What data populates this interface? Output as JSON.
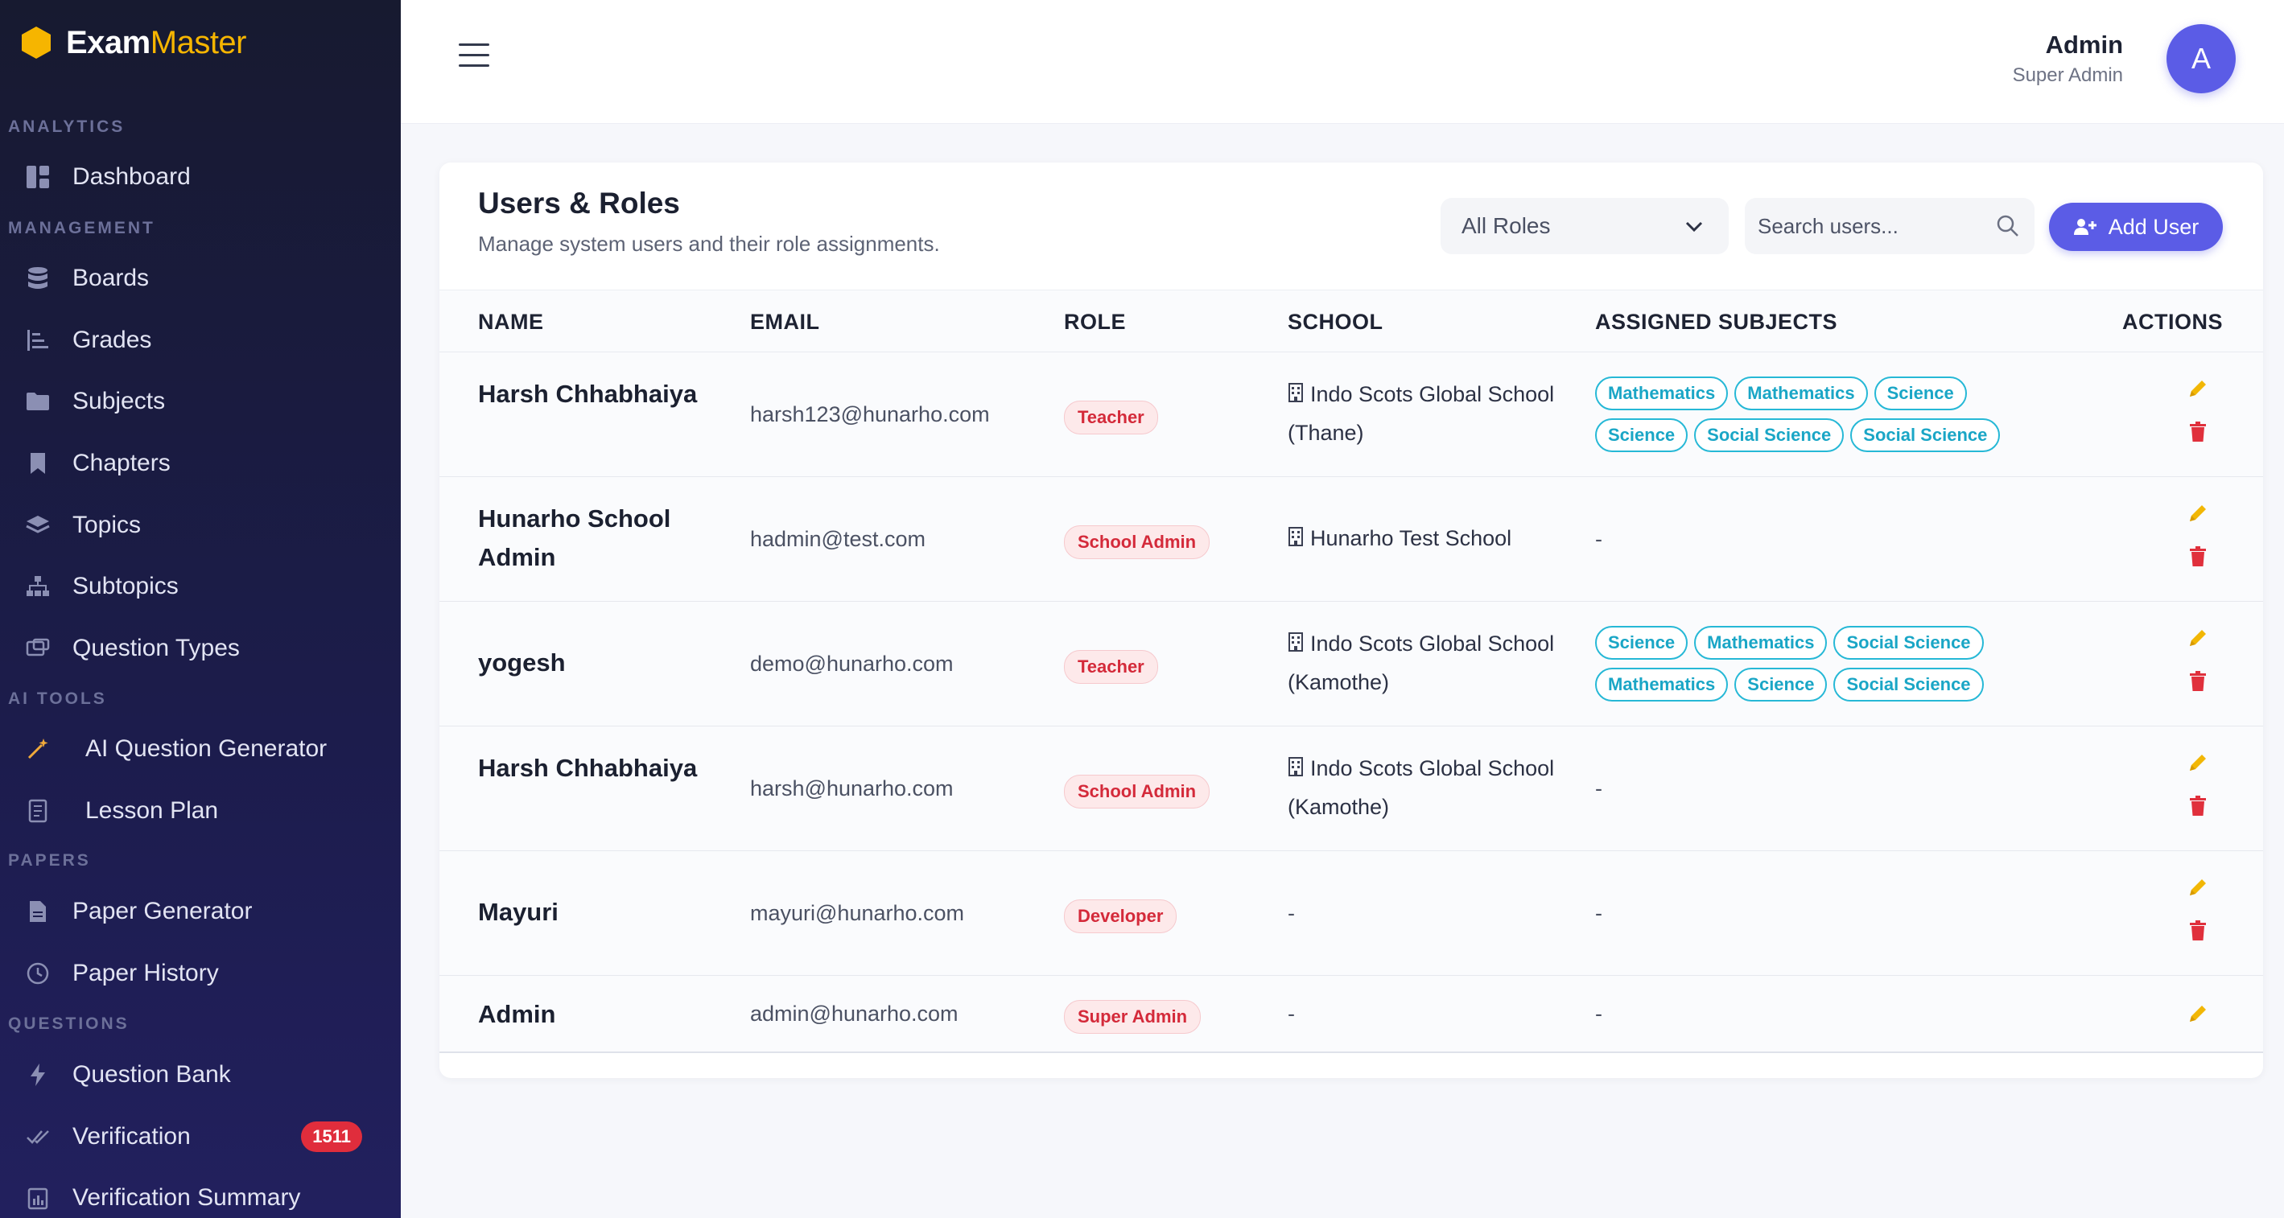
{
  "brand": {
    "name_part1": "Exam",
    "name_part2": "Master"
  },
  "sidebar": {
    "sections": {
      "analytics": "ANALYTICS",
      "management": "MANAGEMENT",
      "ai_tools": "AI TOOLS",
      "papers": "PAPERS",
      "questions": "QUESTIONS"
    },
    "items": {
      "dashboard": "Dashboard",
      "boards": "Boards",
      "grades": "Grades",
      "subjects": "Subjects",
      "chapters": "Chapters",
      "topics": "Topics",
      "subtopics": "Subtopics",
      "question_types": "Question Types",
      "ai_question_generator": "AI Question Generator",
      "lesson_plan": "Lesson Plan",
      "paper_generator": "Paper Generator",
      "paper_history": "Paper History",
      "question_bank": "Question Bank",
      "verification": "Verification",
      "verification_summary": "Verification Summary"
    },
    "verification_badge": "1511"
  },
  "header": {
    "user_name": "Admin",
    "user_role": "Super Admin",
    "avatar_letter": "A"
  },
  "page": {
    "title": "Users & Roles",
    "subtitle": "Manage system users and their role assignments.",
    "roles_filter": "All Roles",
    "search_placeholder": "Search users...",
    "add_user_label": "Add User"
  },
  "table": {
    "headers": {
      "name": "NAME",
      "email": "EMAIL",
      "role": "ROLE",
      "school": "SCHOOL",
      "subjects": "ASSIGNED SUBJECTS",
      "actions": "ACTIONS"
    },
    "rows": [
      {
        "name": "Harsh Chhabhaiya",
        "email": "harsh123@hunarho.com",
        "role": "Teacher",
        "school": "Indo Scots Global School (Thane)",
        "subjects": [
          "Mathematics",
          "Mathematics",
          "Science",
          "Science",
          "Social Science",
          "Social Science"
        ]
      },
      {
        "name": "Hunarho School Admin",
        "email": "hadmin@test.com",
        "role": "School Admin",
        "school": "Hunarho Test School",
        "subjects_empty": "-"
      },
      {
        "name": "yogesh",
        "email": "demo@hunarho.com",
        "role": "Teacher",
        "school": "Indo Scots Global School (Kamothe)",
        "subjects": [
          "Science",
          "Mathematics",
          "Social Science",
          "Mathematics",
          "Science",
          "Social Science"
        ]
      },
      {
        "name": "Harsh Chhabhaiya",
        "email": "harsh@hunarho.com",
        "role": "School Admin",
        "school": "Indo Scots Global School (Kamothe)",
        "subjects_empty": "-"
      },
      {
        "name": "Mayuri",
        "email": "mayuri@hunarho.com",
        "role": "Developer",
        "school_empty": "-",
        "subjects_empty": "-"
      },
      {
        "name": "Admin",
        "email": "admin@hunarho.com",
        "role": "Super Admin",
        "school_empty": "-",
        "subjects_empty": "-"
      }
    ]
  },
  "colors": {
    "accent": "#5b5ce6",
    "sidebar_bg": "#1a1b3f",
    "role_badge": "#d42a3a",
    "subject_chip": "#26b8d6",
    "badge_red": "#e02d3c",
    "edit_icon": "#f2b705",
    "delete_icon": "#e0303c"
  },
  "icons": {
    "brand": "hexagon-logo-icon",
    "edit": "pencil-icon",
    "delete": "trash-icon",
    "school": "building-icon"
  }
}
